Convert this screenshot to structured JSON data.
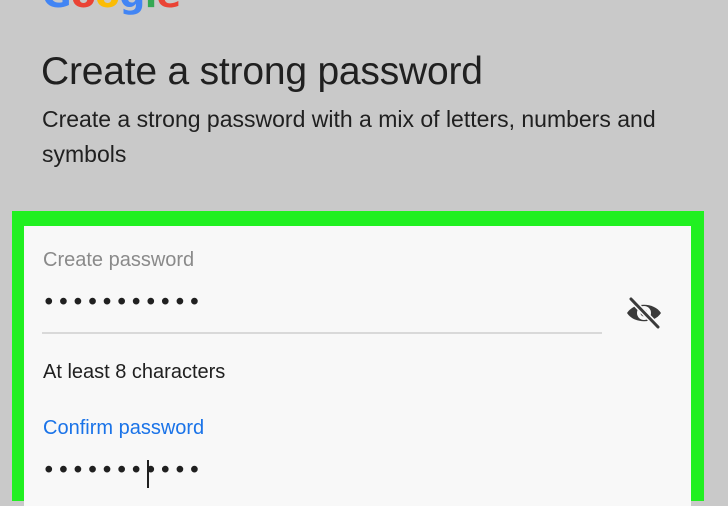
{
  "logo": {
    "letters": [
      {
        "char": "G",
        "color": "#4285f4"
      },
      {
        "char": "o",
        "color": "#ea4335"
      },
      {
        "char": "o",
        "color": "#fbbc05"
      },
      {
        "char": "g",
        "color": "#4285f4"
      },
      {
        "char": "l",
        "color": "#34a853"
      },
      {
        "char": "e",
        "color": "#ea4335"
      }
    ]
  },
  "header": {
    "title": "Create a strong password",
    "subtitle": "Create a strong password with a mix of letters, numbers and symbols"
  },
  "form": {
    "password": {
      "label": "Create password",
      "value": "•••••••••••",
      "helper": "At least 8 characters",
      "visibility_icon": "eye-slash-icon"
    },
    "confirm": {
      "label": "Confirm password",
      "value": "•••••••••••"
    }
  },
  "colors": {
    "background": "#c9c9c9",
    "highlight": "#21f021",
    "card": "#f8f8f8",
    "accent": "#1a73e8",
    "text": "#202020",
    "muted": "#8a8a8a"
  }
}
